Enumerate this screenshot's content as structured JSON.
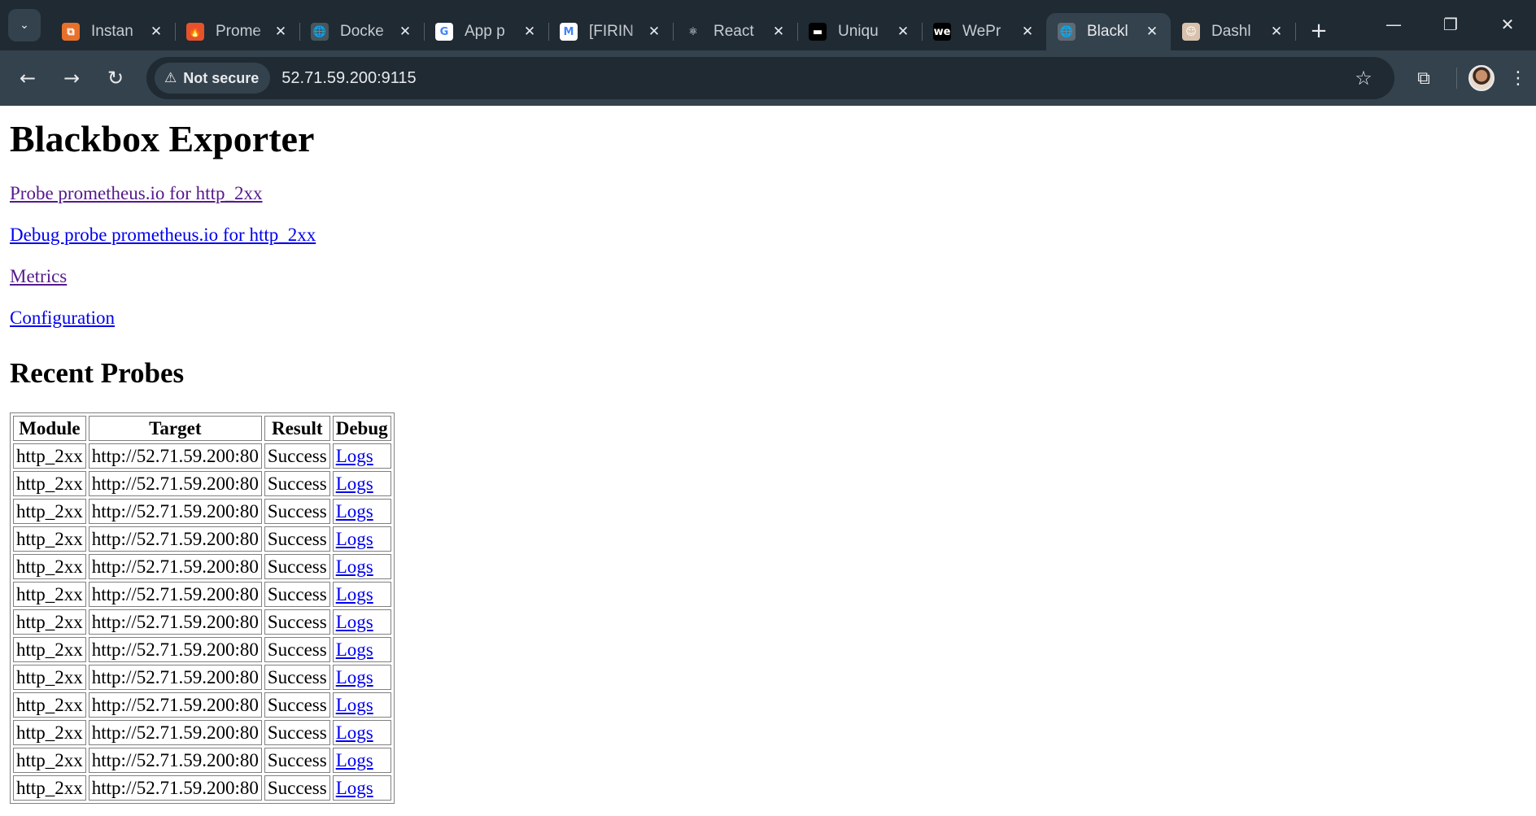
{
  "browser": {
    "tabs": [
      {
        "title": "Instan",
        "favicon": "aws-icon",
        "color": "#e8702a",
        "glyph": "⧉"
      },
      {
        "title": "Prome",
        "favicon": "prometheus-icon",
        "color": "#e6522c",
        "glyph": "🔥"
      },
      {
        "title": "Docke",
        "favicon": "docker-icon",
        "color": "#46565f",
        "glyph": "🌐"
      },
      {
        "title": "App p",
        "favicon": "google-icon",
        "color": "#ffffff",
        "glyph": "G"
      },
      {
        "title": "[FIRIN",
        "favicon": "gmail-icon",
        "color": "#ffffff",
        "glyph": "M"
      },
      {
        "title": "React",
        "favicon": "react-icon",
        "color": "#1f2a33",
        "glyph": "⚛"
      },
      {
        "title": "Uniqu",
        "favicon": "unique-icon",
        "color": "#000000",
        "glyph": "▬"
      },
      {
        "title": "WePr",
        "favicon": "we-icon",
        "color": "#000000",
        "glyph": "we"
      },
      {
        "title": "Blackl",
        "favicon": "globe-icon",
        "color": "#5f6b74",
        "glyph": "🌐"
      },
      {
        "title": "Dashl",
        "favicon": "jenkins-icon",
        "color": "#d8c2ad",
        "glyph": "☺"
      }
    ],
    "active_tab_index": 8,
    "security_label": "Not secure",
    "url": "52.71.59.200:9115"
  },
  "page": {
    "title": "Blackbox Exporter",
    "links": [
      {
        "text": "Probe prometheus.io for http_2xx",
        "visited": true
      },
      {
        "text": "Debug probe prometheus.io for http_2xx",
        "visited": false
      },
      {
        "text": "Metrics",
        "visited": true
      },
      {
        "text": "Configuration",
        "visited": false
      }
    ],
    "recent_probes_heading": "Recent Probes",
    "table": {
      "headers": [
        "Module",
        "Target",
        "Result",
        "Debug"
      ],
      "rows": [
        [
          "http_2xx",
          "http://52.71.59.200:80",
          "Success",
          "Logs"
        ],
        [
          "http_2xx",
          "http://52.71.59.200:80",
          "Success",
          "Logs"
        ],
        [
          "http_2xx",
          "http://52.71.59.200:80",
          "Success",
          "Logs"
        ],
        [
          "http_2xx",
          "http://52.71.59.200:80",
          "Success",
          "Logs"
        ],
        [
          "http_2xx",
          "http://52.71.59.200:80",
          "Success",
          "Logs"
        ],
        [
          "http_2xx",
          "http://52.71.59.200:80",
          "Success",
          "Logs"
        ],
        [
          "http_2xx",
          "http://52.71.59.200:80",
          "Success",
          "Logs"
        ],
        [
          "http_2xx",
          "http://52.71.59.200:80",
          "Success",
          "Logs"
        ],
        [
          "http_2xx",
          "http://52.71.59.200:80",
          "Success",
          "Logs"
        ],
        [
          "http_2xx",
          "http://52.71.59.200:80",
          "Success",
          "Logs"
        ],
        [
          "http_2xx",
          "http://52.71.59.200:80",
          "Success",
          "Logs"
        ],
        [
          "http_2xx",
          "http://52.71.59.200:80",
          "Success",
          "Logs"
        ],
        [
          "http_2xx",
          "http://52.71.59.200:80",
          "Success",
          "Logs"
        ]
      ]
    }
  }
}
